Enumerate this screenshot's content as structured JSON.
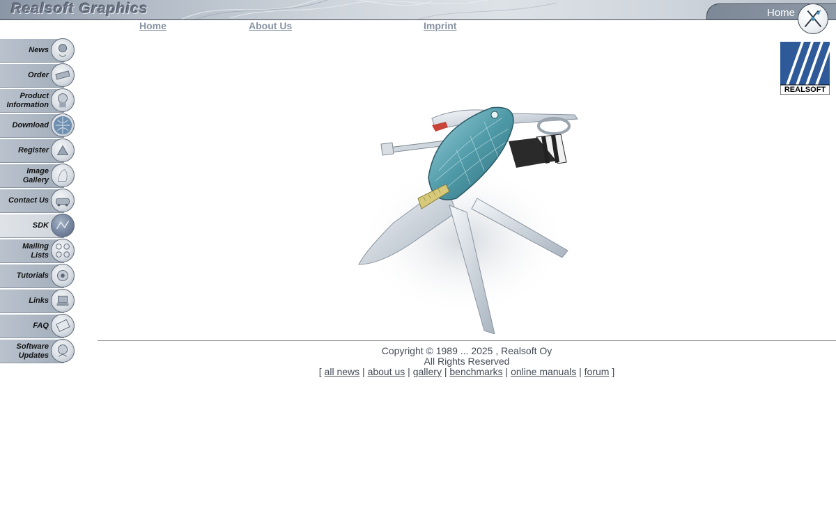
{
  "header": {
    "site_title": "Realsoft Graphics",
    "home_tab_label": "Home"
  },
  "topnav": [
    {
      "label": "Home"
    },
    {
      "label": "About Us"
    },
    {
      "label": "Imprint"
    }
  ],
  "sidebar": {
    "items": [
      {
        "label": "News",
        "icon": "globe-icon"
      },
      {
        "label": "Order",
        "icon": "order-icon"
      },
      {
        "label": "Product\nInformation",
        "icon": "product-info-icon"
      },
      {
        "label": "Download",
        "icon": "download-icon"
      },
      {
        "label": "Register",
        "icon": "register-icon"
      },
      {
        "label": "Image\nGallery",
        "icon": "image-gallery-icon"
      },
      {
        "label": "Contact Us",
        "icon": "contact-icon"
      },
      {
        "label": "SDK",
        "icon": "sdk-icon",
        "active": true
      },
      {
        "label": "Mailing\nLists",
        "icon": "mailing-lists-icon"
      },
      {
        "label": "Tutorials",
        "icon": "tutorials-icon"
      },
      {
        "label": "Links",
        "icon": "links-icon"
      },
      {
        "label": "FAQ",
        "icon": "faq-icon"
      },
      {
        "label": "Software\nUpdates",
        "icon": "software-updates-icon"
      }
    ]
  },
  "logo": {
    "text": "REALSOFT"
  },
  "footer": {
    "copyright": "Copyright © 1989 ... 2025 , Realsoft Oy",
    "rights": "All Rights Reserved",
    "bracket_open": "[",
    "bracket_close": "]",
    "separator": "|",
    "links": [
      {
        "label": "all news"
      },
      {
        "label": "about us"
      },
      {
        "label": "gallery"
      },
      {
        "label": "benchmarks"
      },
      {
        "label": "online manuals"
      },
      {
        "label": "forum"
      }
    ]
  },
  "colors": {
    "header_bg": "#cfd5dc",
    "nav_link": "#8793a2",
    "sidebar_bar": "#a3aebb",
    "logo_blue": "#2e5a9a",
    "footer_text": "#444a55"
  }
}
